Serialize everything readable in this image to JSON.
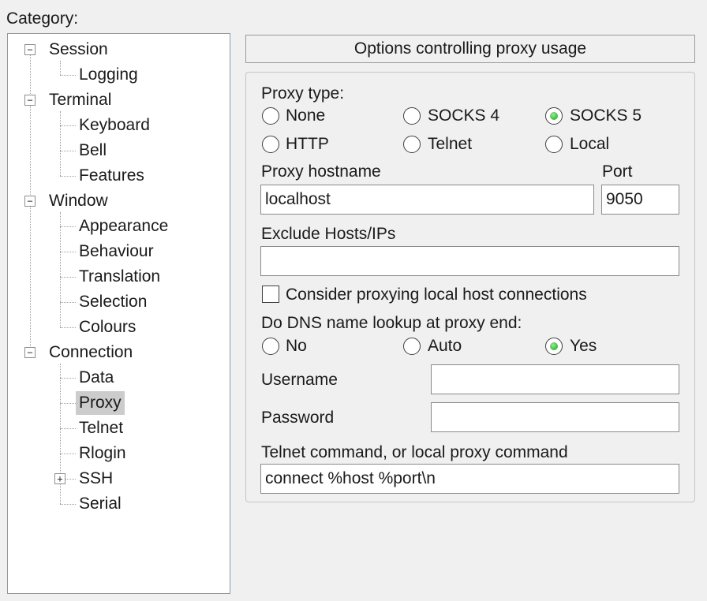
{
  "category_label": "Category:",
  "tree": {
    "session": "Session",
    "logging": "Logging",
    "terminal": "Terminal",
    "keyboard": "Keyboard",
    "bell": "Bell",
    "features": "Features",
    "window": "Window",
    "appearance": "Appearance",
    "behaviour": "Behaviour",
    "translation": "Translation",
    "selection": "Selection",
    "colours": "Colours",
    "connection": "Connection",
    "data": "Data",
    "proxy": "Proxy",
    "telnet": "Telnet",
    "rlogin": "Rlogin",
    "ssh": "SSH",
    "serial": "Serial",
    "expanded_symbol": "−",
    "collapsed_symbol": "+",
    "selected_item": "Proxy"
  },
  "header": "Options controlling proxy usage",
  "proxy_type": {
    "label": "Proxy type:",
    "options": {
      "none": "None",
      "socks4": "SOCKS 4",
      "socks5": "SOCKS 5",
      "http": "HTTP",
      "telnet": "Telnet",
      "local": "Local"
    },
    "selected": "SOCKS 5"
  },
  "hostname": {
    "label": "Proxy hostname",
    "value": "localhost"
  },
  "port": {
    "label": "Port",
    "value": "9050"
  },
  "exclude": {
    "label": "Exclude Hosts/IPs",
    "value": ""
  },
  "consider_local": {
    "label": "Consider proxying local host connections",
    "checked": false
  },
  "dns": {
    "label": "Do DNS name lookup at proxy end:",
    "options": {
      "no": "No",
      "auto": "Auto",
      "yes": "Yes"
    },
    "selected": "Yes"
  },
  "username": {
    "label": "Username",
    "value": ""
  },
  "password": {
    "label": "Password",
    "value": ""
  },
  "command": {
    "label": "Telnet command, or local proxy command",
    "value": "connect %host %port\\n"
  },
  "colors": {
    "radio_selected": "#22aa22",
    "selection_bg": "#cccccc",
    "border": "#8a9ba8"
  }
}
